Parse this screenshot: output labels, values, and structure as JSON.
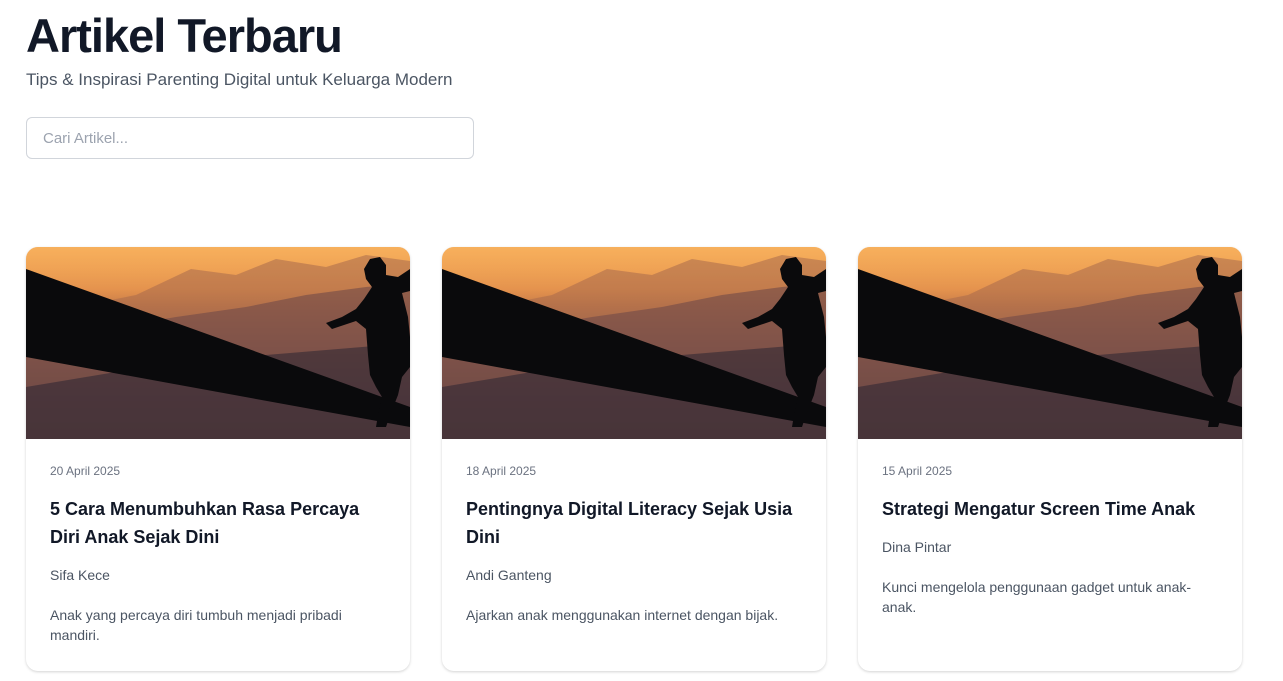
{
  "header": {
    "title": "Artikel Terbaru",
    "subtitle": "Tips & Inspirasi Parenting Digital untuk Keluarga Modern"
  },
  "search": {
    "placeholder": "Cari Artikel...",
    "value": ""
  },
  "articles": [
    {
      "date": "20 April 2025",
      "title": "5 Cara Menumbuhkan Rasa Percaya Diri Anak Sejak Dini",
      "author": "Sifa Kece",
      "excerpt": "Anak yang percaya diri tumbuh menjadi pribadi mandiri."
    },
    {
      "date": "18 April 2025",
      "title": "Pentingnya Digital Literacy Sejak Usia Dini",
      "author": "Andi Ganteng",
      "excerpt": "Ajarkan anak menggunakan internet dengan bijak."
    },
    {
      "date": "15 April 2025",
      "title": "Strategi Mengatur Screen Time Anak",
      "author": "Dina Pintar",
      "excerpt": "Kunci mengelola penggunaan gadget untuk anak-anak."
    }
  ],
  "colors": {
    "title": "#111827",
    "text": "#4b5563",
    "muted": "#6b7280",
    "border": "#d1d5db",
    "sky_top": "#f29d4a",
    "sky_bottom": "#1b1d2a"
  }
}
